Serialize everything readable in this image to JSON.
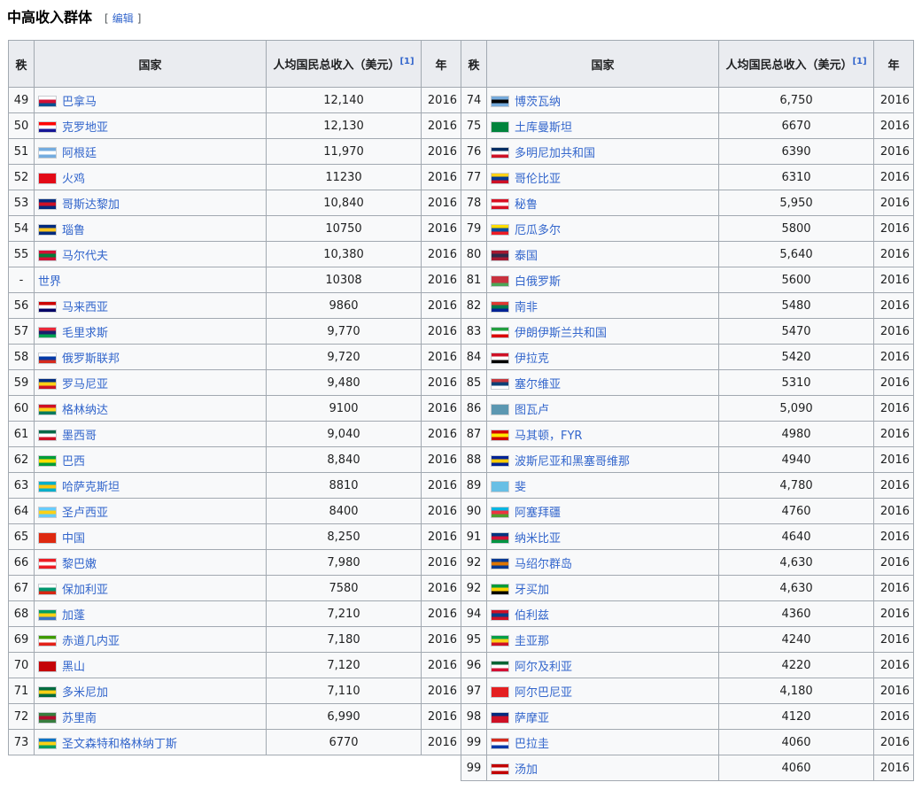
{
  "section": {
    "title": "中高收入群体",
    "edit_open": "[",
    "edit_label": "编辑",
    "edit_close": "]"
  },
  "table": {
    "headers": {
      "rank": "秩",
      "country": "国家",
      "income": "人均国民总收入（美元）",
      "ref": "[1]",
      "year": "年"
    },
    "left_rows": [
      {
        "rank": "49",
        "country": "巴拿马",
        "income": "12,140",
        "year": "2016",
        "flag": [
          "#ffffff",
          "#d21034",
          "#005293"
        ]
      },
      {
        "rank": "50",
        "country": "克罗地亚",
        "income": "12,130",
        "year": "2016",
        "flag": [
          "#ff0000",
          "#ffffff",
          "#171796"
        ]
      },
      {
        "rank": "51",
        "country": "阿根廷",
        "income": "11,970",
        "year": "2016",
        "flag": [
          "#74acdf",
          "#ffffff",
          "#74acdf"
        ]
      },
      {
        "rank": "52",
        "country": "火鸡",
        "income": "11230",
        "year": "2016",
        "flag": [
          "#e30a17",
          "#e30a17",
          "#e30a17"
        ]
      },
      {
        "rank": "53",
        "country": "哥斯达黎加",
        "income": "10,840",
        "year": "2016",
        "flag": [
          "#002b7f",
          "#ce1126",
          "#002b7f"
        ]
      },
      {
        "rank": "54",
        "country": "瑙鲁",
        "income": "10750",
        "year": "2016",
        "flag": [
          "#002b7f",
          "#ffc61e",
          "#002b7f"
        ]
      },
      {
        "rank": "55",
        "country": "马尔代夫",
        "income": "10,380",
        "year": "2016",
        "flag": [
          "#d21034",
          "#007e3a",
          "#d21034"
        ]
      },
      {
        "rank": "-",
        "country": "世界",
        "income": "10308",
        "year": "2016",
        "flag": null
      },
      {
        "rank": "56",
        "country": "马来西亚",
        "income": "9860",
        "year": "2016",
        "flag": [
          "#cc0001",
          "#ffffff",
          "#010066"
        ]
      },
      {
        "rank": "57",
        "country": "毛里求斯",
        "income": "9,770",
        "year": "2016",
        "flag": [
          "#ea2839",
          "#1a206d",
          "#00a551"
        ]
      },
      {
        "rank": "58",
        "country": "俄罗斯联邦",
        "income": "9,720",
        "year": "2016",
        "flag": [
          "#ffffff",
          "#0039a6",
          "#d52b1e"
        ]
      },
      {
        "rank": "59",
        "country": "罗马尼亚",
        "income": "9,480",
        "year": "2016",
        "flag": [
          "#002b7f",
          "#fcd116",
          "#ce1126"
        ]
      },
      {
        "rank": "60",
        "country": "格林纳达",
        "income": "9100",
        "year": "2016",
        "flag": [
          "#ce1126",
          "#fcd116",
          "#007a5e"
        ]
      },
      {
        "rank": "61",
        "country": "墨西哥",
        "income": "9,040",
        "year": "2016",
        "flag": [
          "#006847",
          "#ffffff",
          "#ce1126"
        ]
      },
      {
        "rank": "62",
        "country": "巴西",
        "income": "8,840",
        "year": "2016",
        "flag": [
          "#009c3b",
          "#ffdf00",
          "#009c3b"
        ]
      },
      {
        "rank": "63",
        "country": "哈萨克斯坦",
        "income": "8810",
        "year": "2016",
        "flag": [
          "#00afca",
          "#fec50c",
          "#00afca"
        ]
      },
      {
        "rank": "64",
        "country": "圣卢西亚",
        "income": "8400",
        "year": "2016",
        "flag": [
          "#66ccff",
          "#fcd116",
          "#66ccff"
        ]
      },
      {
        "rank": "65",
        "country": "中国",
        "income": "8,250",
        "year": "2016",
        "flag": [
          "#de2910",
          "#de2910",
          "#de2910"
        ]
      },
      {
        "rank": "66",
        "country": "黎巴嫩",
        "income": "7,980",
        "year": "2016",
        "flag": [
          "#ed1c24",
          "#ffffff",
          "#ed1c24"
        ]
      },
      {
        "rank": "67",
        "country": "保加利亚",
        "income": "7580",
        "year": "2016",
        "flag": [
          "#ffffff",
          "#00966e",
          "#d62612"
        ]
      },
      {
        "rank": "68",
        "country": "加蓬",
        "income": "7,210",
        "year": "2016",
        "flag": [
          "#009e60",
          "#fcd116",
          "#3a75c4"
        ]
      },
      {
        "rank": "69",
        "country": "赤道几内亚",
        "income": "7,180",
        "year": "2016",
        "flag": [
          "#3e9a00",
          "#ffffff",
          "#e32118"
        ]
      },
      {
        "rank": "70",
        "country": "黑山",
        "income": "7,120",
        "year": "2016",
        "flag": [
          "#c40308",
          "#c40308",
          "#c40308"
        ]
      },
      {
        "rank": "71",
        "country": "多米尼加",
        "income": "7,110",
        "year": "2016",
        "flag": [
          "#006b3f",
          "#fcd116",
          "#006b3f"
        ]
      },
      {
        "rank": "72",
        "country": "苏里南",
        "income": "6,990",
        "year": "2016",
        "flag": [
          "#377e3f",
          "#b40a2d",
          "#377e3f"
        ]
      },
      {
        "rank": "73",
        "country": "圣文森特和格林纳丁斯",
        "income": "6770",
        "year": "2016",
        "flag": [
          "#0072c6",
          "#fcd116",
          "#009e60"
        ]
      }
    ],
    "right_rows": [
      {
        "rank": "74",
        "country": "博茨瓦纳",
        "income": "6,750",
        "year": "2016",
        "flag": [
          "#75aadb",
          "#000000",
          "#75aadb"
        ]
      },
      {
        "rank": "75",
        "country": "土库曼斯坦",
        "income": "6670",
        "year": "2016",
        "flag": [
          "#00843d",
          "#00843d",
          "#00843d"
        ]
      },
      {
        "rank": "76",
        "country": "多明尼加共和国",
        "income": "6390",
        "year": "2016",
        "flag": [
          "#002d62",
          "#ffffff",
          "#ce1126"
        ]
      },
      {
        "rank": "77",
        "country": "哥伦比亚",
        "income": "6310",
        "year": "2016",
        "flag": [
          "#fcd116",
          "#003893",
          "#ce1126"
        ]
      },
      {
        "rank": "78",
        "country": "秘鲁",
        "income": "5,950",
        "year": "2016",
        "flag": [
          "#d91023",
          "#ffffff",
          "#d91023"
        ]
      },
      {
        "rank": "79",
        "country": "厄瓜多尔",
        "income": "5800",
        "year": "2016",
        "flag": [
          "#ffdd00",
          "#034ea2",
          "#ed1c24"
        ]
      },
      {
        "rank": "80",
        "country": "泰国",
        "income": "5,640",
        "year": "2016",
        "flag": [
          "#a51931",
          "#2d2a4a",
          "#a51931"
        ]
      },
      {
        "rank": "81",
        "country": "白俄罗斯",
        "income": "5600",
        "year": "2016",
        "flag": [
          "#c8313e",
          "#c8313e",
          "#4aa657"
        ]
      },
      {
        "rank": "82",
        "country": "南非",
        "income": "5480",
        "year": "2016",
        "flag": [
          "#de3831",
          "#007a4d",
          "#002395"
        ]
      },
      {
        "rank": "83",
        "country": "伊朗伊斯兰共和国",
        "income": "5470",
        "year": "2016",
        "flag": [
          "#239f40",
          "#ffffff",
          "#da0000"
        ]
      },
      {
        "rank": "84",
        "country": "伊拉克",
        "income": "5420",
        "year": "2016",
        "flag": [
          "#ce1126",
          "#ffffff",
          "#000000"
        ]
      },
      {
        "rank": "85",
        "country": "塞尔维亚",
        "income": "5310",
        "year": "2016",
        "flag": [
          "#c6363c",
          "#0c4076",
          "#ffffff"
        ]
      },
      {
        "rank": "86",
        "country": "图瓦卢",
        "income": "5,090",
        "year": "2016",
        "flag": [
          "#5b97b1",
          "#5b97b1",
          "#5b97b1"
        ]
      },
      {
        "rank": "87",
        "country": "马其顿，FYR",
        "income": "4980",
        "year": "2016",
        "flag": [
          "#d20000",
          "#ffe600",
          "#d20000"
        ]
      },
      {
        "rank": "88",
        "country": "波斯尼亚和黑塞哥维那",
        "income": "4940",
        "year": "2016",
        "flag": [
          "#002395",
          "#fecb00",
          "#002395"
        ]
      },
      {
        "rank": "89",
        "country": "斐",
        "income": "4,780",
        "year": "2016",
        "flag": [
          "#68bfe5",
          "#68bfe5",
          "#68bfe5"
        ]
      },
      {
        "rank": "90",
        "country": "阿塞拜疆",
        "income": "4760",
        "year": "2016",
        "flag": [
          "#00b5e2",
          "#ef3340",
          "#509e2f"
        ]
      },
      {
        "rank": "91",
        "country": "纳米比亚",
        "income": "4640",
        "year": "2016",
        "flag": [
          "#003580",
          "#d21034",
          "#009543"
        ]
      },
      {
        "rank": "92",
        "country": "马绍尔群岛",
        "income": "4,630",
        "year": "2016",
        "flag": [
          "#003893",
          "#dd7500",
          "#003893"
        ]
      },
      {
        "rank": "92",
        "country": "牙买加",
        "income": "4,630",
        "year": "2016",
        "flag": [
          "#009b3a",
          "#fed100",
          "#000000"
        ]
      },
      {
        "rank": "94",
        "country": "伯利兹",
        "income": "4360",
        "year": "2016",
        "flag": [
          "#ce1126",
          "#003f87",
          "#ce1126"
        ]
      },
      {
        "rank": "95",
        "country": "圭亚那",
        "income": "4240",
        "year": "2016",
        "flag": [
          "#009e49",
          "#fcd116",
          "#ce1126"
        ]
      },
      {
        "rank": "96",
        "country": "阿尔及利亚",
        "income": "4220",
        "year": "2016",
        "flag": [
          "#006233",
          "#ffffff",
          "#d21034"
        ]
      },
      {
        "rank": "97",
        "country": "阿尔巴尼亚",
        "income": "4,180",
        "year": "2016",
        "flag": [
          "#e41e20",
          "#e41e20",
          "#e41e20"
        ]
      },
      {
        "rank": "98",
        "country": "萨摩亚",
        "income": "4120",
        "year": "2016",
        "flag": [
          "#002b7f",
          "#ce1126",
          "#ce1126"
        ]
      },
      {
        "rank": "99",
        "country": "巴拉圭",
        "income": "4060",
        "year": "2016",
        "flag": [
          "#d52b1e",
          "#ffffff",
          "#0038a8"
        ]
      },
      {
        "rank": "99",
        "country": "汤加",
        "income": "4060",
        "year": "2016",
        "flag": [
          "#c10000",
          "#ffffff",
          "#c10000"
        ]
      }
    ]
  }
}
